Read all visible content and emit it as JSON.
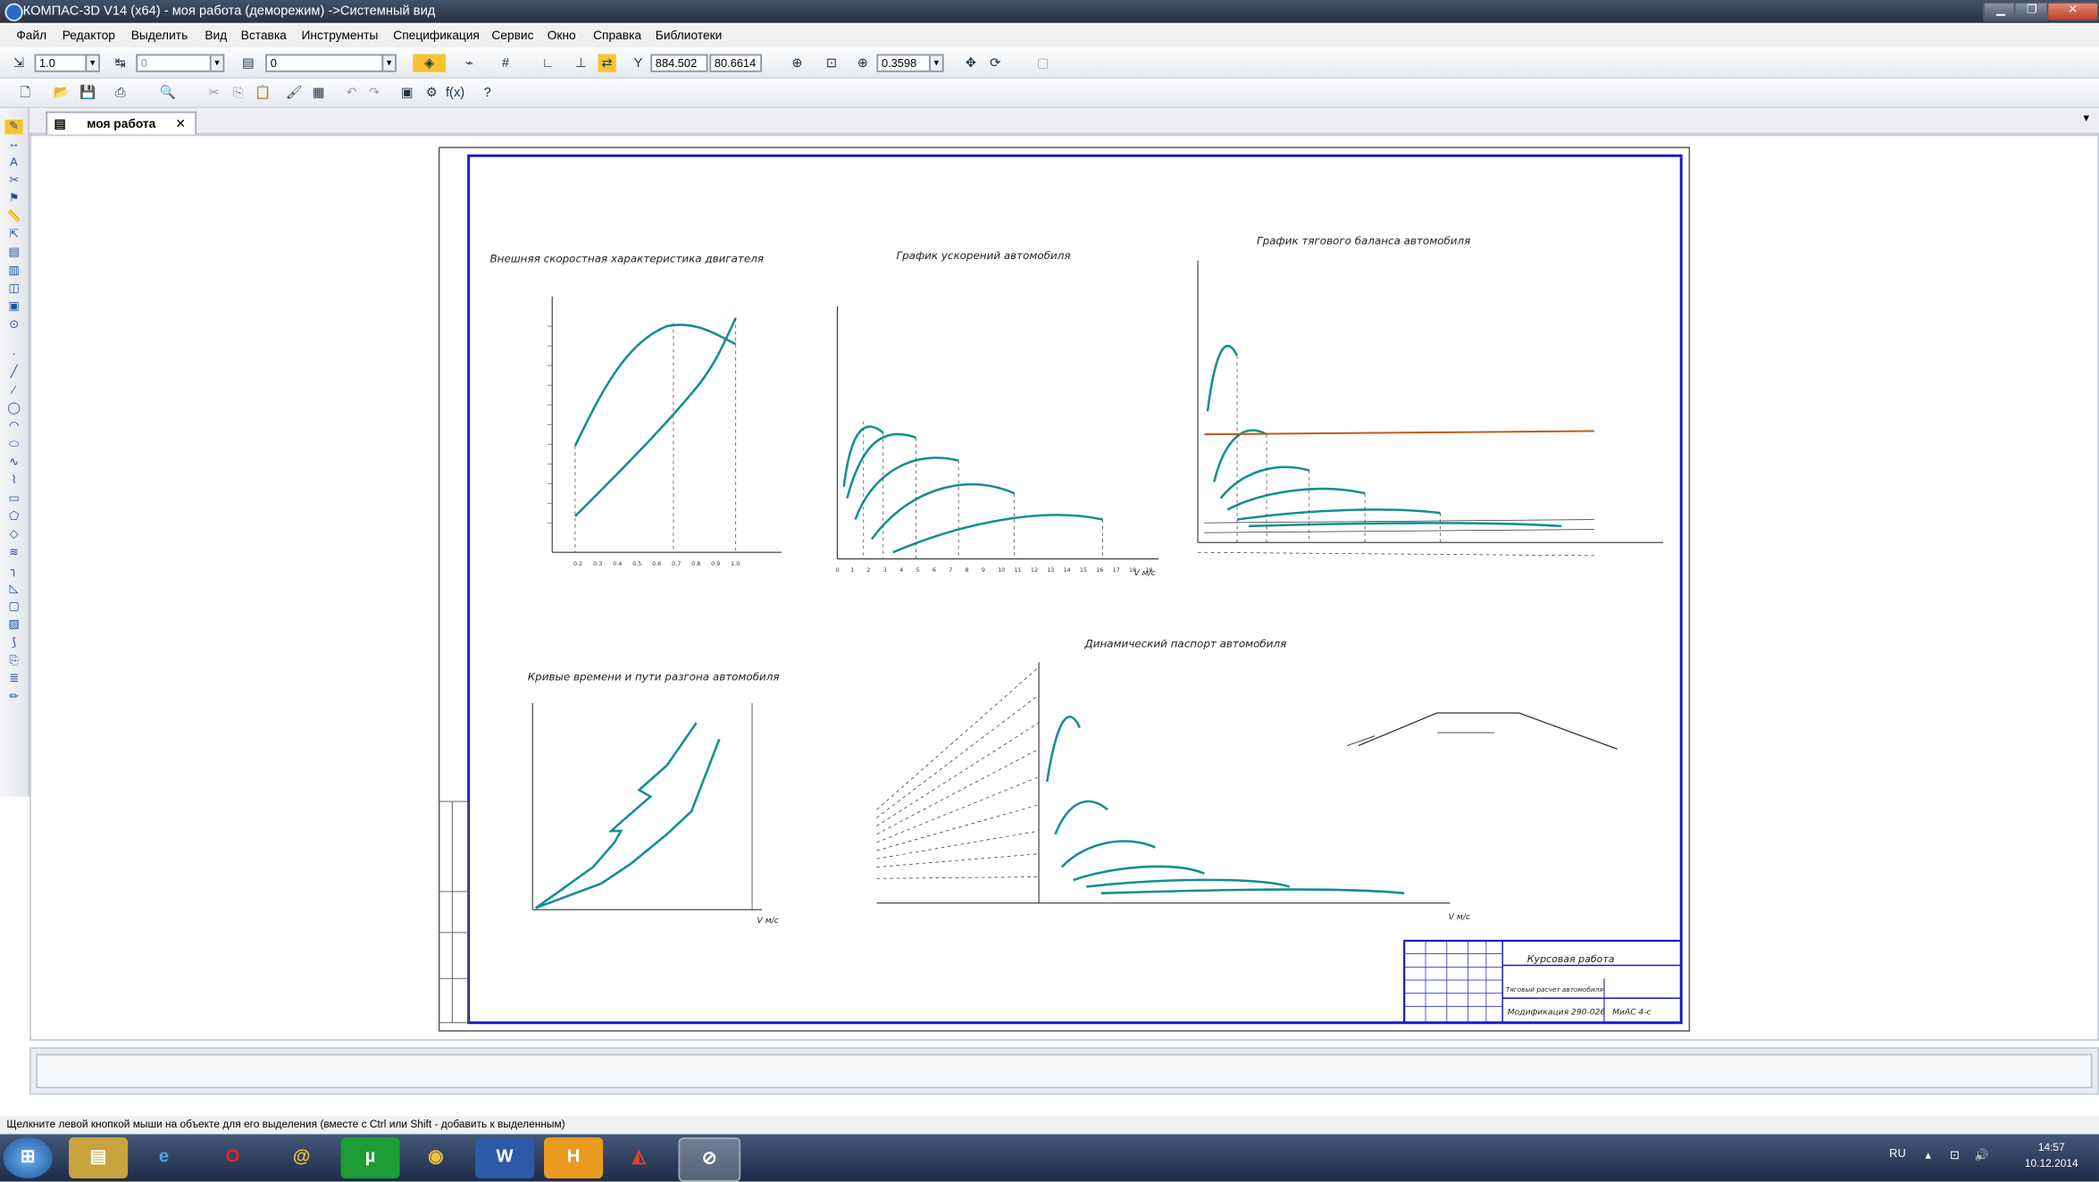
{
  "window": {
    "title": "КОМПАС-3D V14 (x64) - моя работа (деморежим) ->Системный вид",
    "minimize": "▁",
    "restore": "❐",
    "close": "✕"
  },
  "menu": [
    "Файл",
    "Редактор",
    "Выделить",
    "Вид",
    "Вставка",
    "Инструменты",
    "Спецификация",
    "Сервис",
    "Окно",
    "Справка",
    "Библиотеки"
  ],
  "toolbar1": {
    "scale_value": "1.0",
    "step_value": "0",
    "layer_value": "0",
    "coord_x": "884.502",
    "coord_y": "80.6614",
    "zoom_value": "0.3598"
  },
  "tab": {
    "label": "моя работа",
    "close": "✕"
  },
  "drawing": {
    "chart1_title": "Внешняя скоростная характеристика двигателя",
    "chart2_title": "График ускорений автомобиля",
    "chart3_title": "График тягового баланса автомобиля",
    "chart4_title": "Кривые времени и пути разгона автомобиля",
    "chart5_title": "Динамический паспорт автомобиля",
    "chart2_xlabel": "V м/с",
    "chart4_xlabel": "V м/с",
    "chart5_xlabel": "V м/с",
    "stamp_title": "Курсовая работа",
    "stamp_sub": "Тяговый расчет автомобиля",
    "stamp_model": "Модификация 290-026",
    "stamp_org": "МиАС 4-с"
  },
  "statusbar": {
    "hint": "Щелкните левой кнопкой мыши на объекте для его выделения (вместе с Ctrl или Shift - добавить к выделенным)"
  },
  "taskbar": {
    "lang": "RU",
    "time": "14:57",
    "date": "10.12.2014",
    "apps": [
      "start-orb",
      "explorer",
      "internet-explorer",
      "opera",
      "mail",
      "utorrent",
      "chrome",
      "word",
      "h-app",
      "kompas-app",
      "kompas-3d"
    ]
  },
  "colors": {
    "curve": "#138f8f",
    "frame": "#1a1acc",
    "line": "#c25a1a"
  }
}
